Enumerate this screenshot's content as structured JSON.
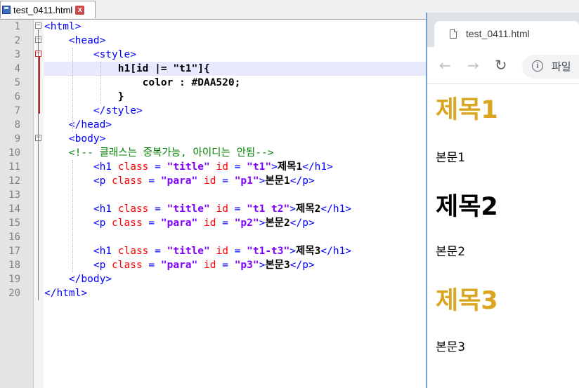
{
  "editor": {
    "tab": {
      "label": "test_0411.html",
      "close": "x"
    },
    "current_line": 4,
    "lines": [
      {
        "n": "1",
        "tokens": [
          {
            "c": "t-tag",
            "t": "<html>"
          }
        ]
      },
      {
        "n": "2",
        "tokens": [
          {
            "c": "t-tag",
            "t": "    <head>"
          }
        ]
      },
      {
        "n": "3",
        "tokens": [
          {
            "c": "t-tag",
            "t": "        <style>"
          }
        ]
      },
      {
        "n": "4",
        "tokens": [
          {
            "c": "t-css",
            "t": "            h1[id |= \"t1\"]{"
          }
        ]
      },
      {
        "n": "5",
        "tokens": [
          {
            "c": "t-css",
            "t": "                color : #DAA520;"
          }
        ]
      },
      {
        "n": "6",
        "tokens": [
          {
            "c": "t-css",
            "t": "            }"
          }
        ]
      },
      {
        "n": "7",
        "tokens": [
          {
            "c": "t-tag",
            "t": "        </style>"
          }
        ]
      },
      {
        "n": "8",
        "tokens": [
          {
            "c": "t-tag",
            "t": "    </head>"
          }
        ]
      },
      {
        "n": "9",
        "tokens": [
          {
            "c": "t-tag",
            "t": "    <body>"
          }
        ]
      },
      {
        "n": "10",
        "tokens": [
          {
            "c": "t-cmt",
            "t": "    <!-- 클래스는 중복가능, 아이디는 안됨-->"
          }
        ]
      },
      {
        "n": "11",
        "tokens": [
          {
            "c": "t-tag",
            "t": "        <h1 "
          },
          {
            "c": "t-attr",
            "t": "class"
          },
          {
            "c": "t-tag",
            "t": " = "
          },
          {
            "c": "t-val",
            "t": "\"title\""
          },
          {
            "c": "t-attr",
            "t": " id"
          },
          {
            "c": "t-tag",
            "t": " = "
          },
          {
            "c": "t-val",
            "t": "\"t1\""
          },
          {
            "c": "t-tag",
            "t": ">"
          },
          {
            "c": "t-text",
            "t": "제목1"
          },
          {
            "c": "t-tag",
            "t": "</h1>"
          }
        ]
      },
      {
        "n": "12",
        "tokens": [
          {
            "c": "t-tag",
            "t": "        <p "
          },
          {
            "c": "t-attr",
            "t": "class"
          },
          {
            "c": "t-tag",
            "t": " = "
          },
          {
            "c": "t-val",
            "t": "\"para\""
          },
          {
            "c": "t-attr",
            "t": " id"
          },
          {
            "c": "t-tag",
            "t": " = "
          },
          {
            "c": "t-val",
            "t": "\"p1\""
          },
          {
            "c": "t-tag",
            "t": ">"
          },
          {
            "c": "t-text",
            "t": "본문1"
          },
          {
            "c": "t-tag",
            "t": "</p>"
          }
        ]
      },
      {
        "n": "13",
        "tokens": []
      },
      {
        "n": "14",
        "tokens": [
          {
            "c": "t-tag",
            "t": "        <h1 "
          },
          {
            "c": "t-attr",
            "t": "class"
          },
          {
            "c": "t-tag",
            "t": " = "
          },
          {
            "c": "t-val",
            "t": "\"title\""
          },
          {
            "c": "t-attr",
            "t": " id"
          },
          {
            "c": "t-tag",
            "t": " = "
          },
          {
            "c": "t-val",
            "t": "\"t1 t2\""
          },
          {
            "c": "t-tag",
            "t": ">"
          },
          {
            "c": "t-text",
            "t": "제목2"
          },
          {
            "c": "t-tag",
            "t": "</h1>"
          }
        ]
      },
      {
        "n": "15",
        "tokens": [
          {
            "c": "t-tag",
            "t": "        <p "
          },
          {
            "c": "t-attr",
            "t": "class"
          },
          {
            "c": "t-tag",
            "t": " = "
          },
          {
            "c": "t-val",
            "t": "\"para\""
          },
          {
            "c": "t-attr",
            "t": " id"
          },
          {
            "c": "t-tag",
            "t": " = "
          },
          {
            "c": "t-val",
            "t": "\"p2\""
          },
          {
            "c": "t-tag",
            "t": ">"
          },
          {
            "c": "t-text",
            "t": "본문2"
          },
          {
            "c": "t-tag",
            "t": "</p>"
          }
        ]
      },
      {
        "n": "16",
        "tokens": []
      },
      {
        "n": "17",
        "tokens": [
          {
            "c": "t-tag",
            "t": "        <h1 "
          },
          {
            "c": "t-attr",
            "t": "class"
          },
          {
            "c": "t-tag",
            "t": " = "
          },
          {
            "c": "t-val",
            "t": "\"title\""
          },
          {
            "c": "t-attr",
            "t": " id"
          },
          {
            "c": "t-tag",
            "t": " = "
          },
          {
            "c": "t-val",
            "t": "\"t1-t3\""
          },
          {
            "c": "t-tag",
            "t": ">"
          },
          {
            "c": "t-text",
            "t": "제목3"
          },
          {
            "c": "t-tag",
            "t": "</h1>"
          }
        ]
      },
      {
        "n": "18",
        "tokens": [
          {
            "c": "t-tag",
            "t": "        <p "
          },
          {
            "c": "t-attr",
            "t": "class"
          },
          {
            "c": "t-tag",
            "t": " = "
          },
          {
            "c": "t-val",
            "t": "\"para\""
          },
          {
            "c": "t-attr",
            "t": " id"
          },
          {
            "c": "t-tag",
            "t": " = "
          },
          {
            "c": "t-val",
            "t": "\"p3\""
          },
          {
            "c": "t-tag",
            "t": ">"
          },
          {
            "c": "t-text",
            "t": "본문3"
          },
          {
            "c": "t-tag",
            "t": "</p>"
          }
        ]
      },
      {
        "n": "19",
        "tokens": [
          {
            "c": "t-tag",
            "t": "    </body>"
          }
        ]
      },
      {
        "n": "20",
        "tokens": [
          {
            "c": "t-tag",
            "t": "</html>"
          }
        ]
      }
    ]
  },
  "browser": {
    "tab_title": "test_0411.html",
    "address": "파일",
    "page": {
      "h1_1": "제목1",
      "p_1": "본문1",
      "h1_2": "제목2",
      "p_2": "본문2",
      "h1_3": "제목3",
      "p_3": "본문3"
    },
    "colors": {
      "highlight": "#DAA520",
      "default": "#000000"
    }
  }
}
